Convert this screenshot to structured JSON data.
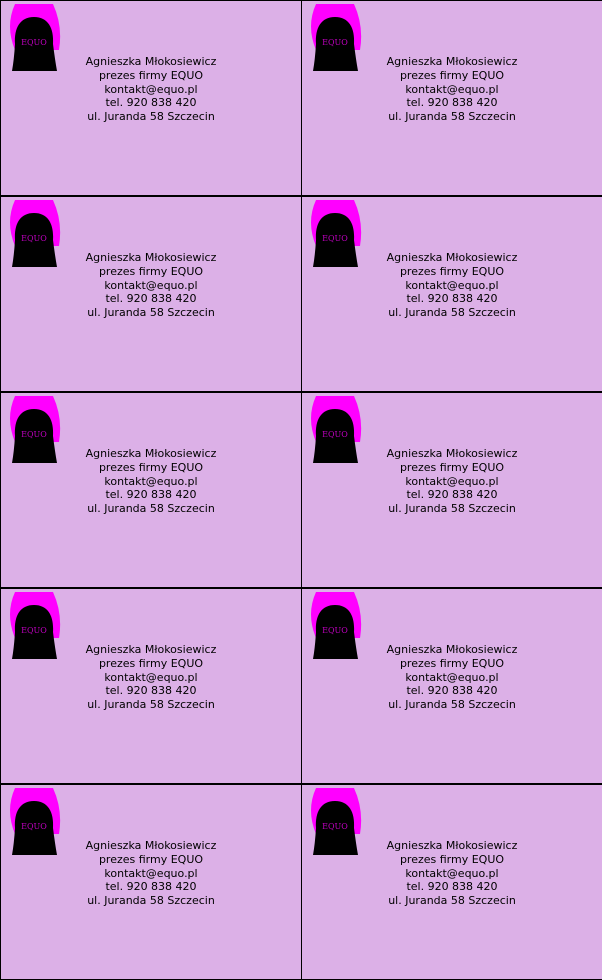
{
  "colors": {
    "card_background": "#dcb0e7",
    "logo_outer": "#ff00ff",
    "logo_inner": "#000000",
    "logo_text": "#c000c0"
  },
  "card": {
    "brand": "EQUO",
    "name": "Agnieszka Młokosiewicz",
    "title": "prezes firmy EQUO",
    "email": "kontakt@equo.pl",
    "phone": "tel. 920 838 420",
    "address": "ul. Juranda 58 Szczecin"
  }
}
